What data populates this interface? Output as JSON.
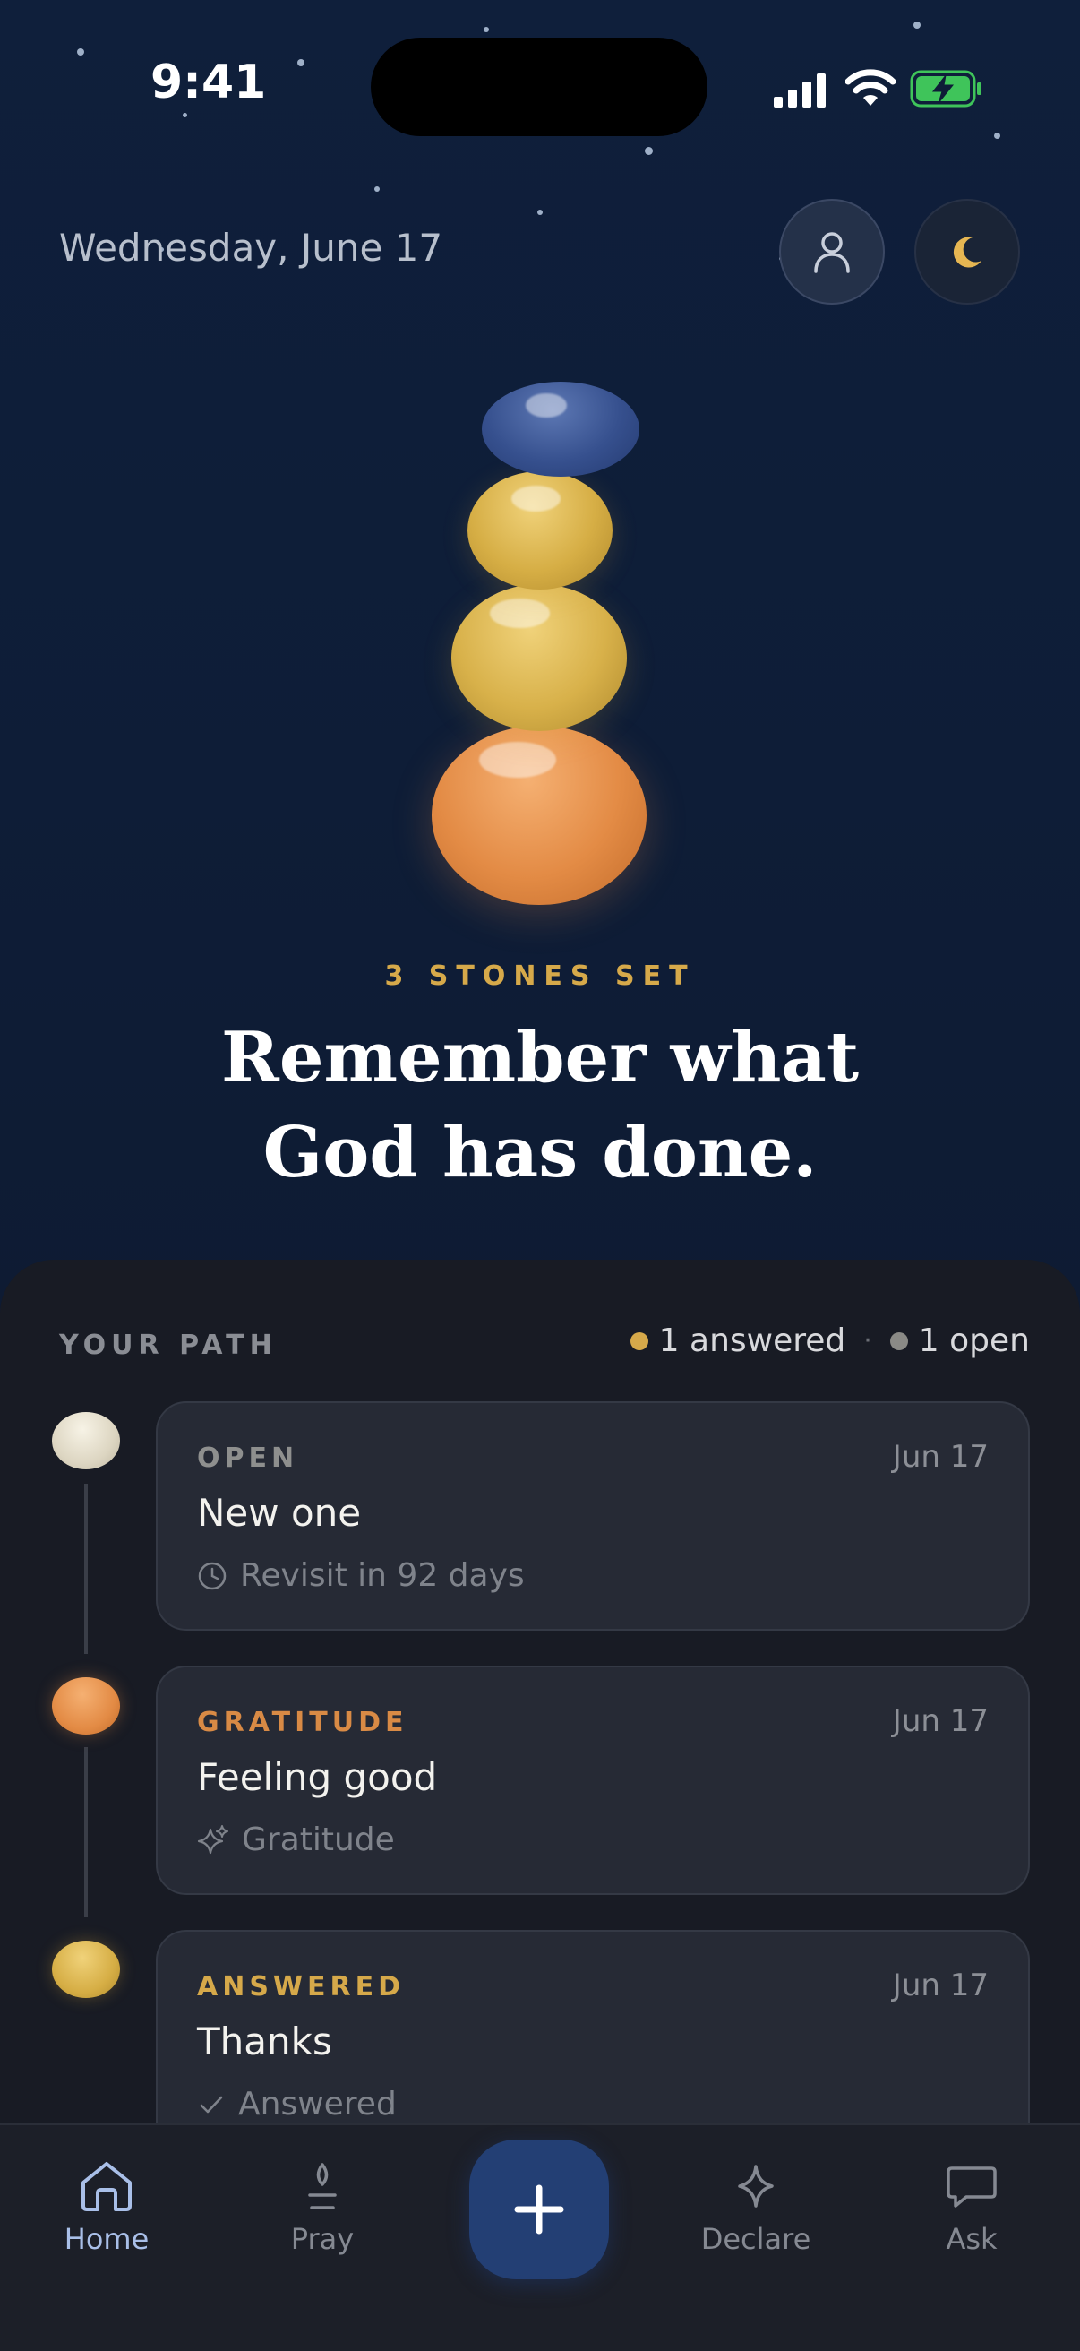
{
  "status_bar": {
    "time": "9:41"
  },
  "header": {
    "date": "Wednesday, June 17",
    "profile_icon": "person-icon",
    "theme_icon": "moon-icon"
  },
  "hero": {
    "stones_label": "3 STONES SET",
    "headline": "Remember what God has done.",
    "stone_colors": [
      "#36508e",
      "#d6ae45",
      "#d8b14a",
      "#e38b45"
    ]
  },
  "path": {
    "title": "YOUR PATH",
    "answered_count": "1 answered",
    "open_count": "1 open",
    "separator": "·",
    "colors": {
      "answered": "#d6a94a",
      "open": "#8a8a86"
    },
    "entries": [
      {
        "type": "OPEN",
        "type_color": "#8e8f8e",
        "date": "Jun 17",
        "title": "New one",
        "meta": "Revisit in 92 days",
        "meta_icon": "clock-icon"
      },
      {
        "type": "GRATITUDE",
        "type_color": "#d88a45",
        "date": "Jun 17",
        "title": "Feeling good",
        "meta": "Gratitude",
        "meta_icon": "sparkles-icon"
      },
      {
        "type": "ANSWERED",
        "type_color": "#d6a94a",
        "date": "Jun 17",
        "title": "Thanks",
        "meta": "Answered",
        "meta_icon": "check-icon"
      }
    ]
  },
  "nav": {
    "items": [
      {
        "label": "Home",
        "icon": "home-icon",
        "active": true
      },
      {
        "label": "Pray",
        "icon": "candle-icon"
      },
      {
        "label": "Declare",
        "icon": "sparkle-icon"
      },
      {
        "label": "Ask",
        "icon": "chat-bubble-icon"
      }
    ],
    "fab_icon": "plus-icon"
  }
}
